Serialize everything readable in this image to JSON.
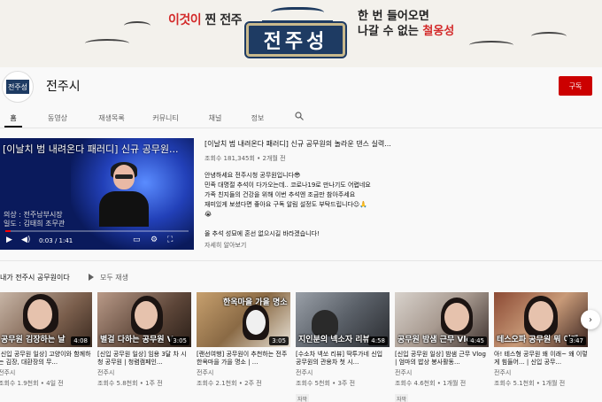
{
  "banner": {
    "left_text_red": "이것이",
    "left_text": " 찐 전주",
    "sign_text": "전주성",
    "right_line1": "한 번 들어오면",
    "right_line2_prefix": "나갈 수 없는 ",
    "right_line2_red": "철옹성"
  },
  "channel": {
    "name": "전주시",
    "avatar_text": "전주성",
    "subscribe_label": "구독"
  },
  "tabs": [
    {
      "label": "홈",
      "active": true
    },
    {
      "label": "동영상",
      "active": false
    },
    {
      "label": "재생목록",
      "active": false
    },
    {
      "label": "커뮤니티",
      "active": false
    },
    {
      "label": "채널",
      "active": false
    },
    {
      "label": "정보",
      "active": false
    }
  ],
  "featured": {
    "player_title": "[이날치 범 내려온다 패러디] 신규 공무원...",
    "caption_line1": "의상 : 전주남부시장",
    "caption_line2": "일도 : 김태희 조무관",
    "time": "0:03 / 1:41",
    "progress": 0.03,
    "title": "[이날치 범 내려온다 패러디] 신규 공무원의 놀라운 댄스 실력...",
    "meta": "조회수 181,345회 • 2개월 전",
    "description": [
      "안녕하세요 전주시청 공무원입니다😎",
      "민족 대명절 추석이 다가오는데.. 코로나19로 만나기도 어렵네요",
      "가족 친지들의 건강을 위해 이번 추석엔 조금만 참아주세요",
      "재미있게 보셨다면 좋아요 구독 알림 설정도 부탁드립니다☺🙏",
      "😭",
      "",
      "올 추석 성묘에 혼선 없으시길 바라겠습니다!"
    ],
    "more_label": "자세히 알아보기"
  },
  "shelf": {
    "title": "내가 전주시 공무원이다",
    "play_all_label": "모두 재생",
    "videos": [
      {
        "thumb_caption": "공무원 김장하는 날",
        "duration": "4:08",
        "title": "[신입 공무원 일상] 고양이와 함께하는 김장, 대환장의 무...",
        "channel": "전주시",
        "meta": "조회수 1.9천회 • 4일 전",
        "badge": ""
      },
      {
        "thumb_caption": "별걸 다하는 공무원 V",
        "duration": "3:05",
        "title": "[신입 공무원 일상] 임용 3달 차 시청 공무원 | 청렴캠페인...",
        "channel": "전주시",
        "meta": "조회수 5.8천회 • 1주 전",
        "badge": ""
      },
      {
        "thumb_caption": "한옥마을 가을 명소",
        "duration": "3:05",
        "title": "[랜선여행] 공무원이 추천하는 전주 한옥마을 가을 명소 | ...",
        "channel": "전주시",
        "meta": "조회수 2.1천회 • 2주 전",
        "badge": ""
      },
      {
        "thumb_caption": "지인분의 넥소자 리뷰",
        "duration": "4:58",
        "title": "[수소차 넥쏘 리뷰] 딱투가네 신입 공무원의 관용차 첫 시...",
        "channel": "전주시",
        "meta": "조회수 5천회 • 3주 전",
        "badge": "자막"
      },
      {
        "thumb_caption": "공무원 밤샘 근무 Vlo",
        "duration": "4:45",
        "title": "[신입 공무원 일상] 밤샘 근무 Vlog | 엄마의 밥상 봉사활동...",
        "channel": "전주시",
        "meta": "조회수 4.6천회 • 1개월 전",
        "badge": "자막"
      },
      {
        "thumb_caption": "테스오파 공무원 뭐 이래",
        "duration": "3:47",
        "title": "아! 테스형 공무원 왜 이래~ 왜 이렇게 힘들어... | 신입 공무...",
        "channel": "전주시",
        "meta": "조회수 5.1천회 • 1개월 전",
        "badge": ""
      }
    ]
  },
  "colors": {
    "subscribe_red": "#cc0000",
    "sign_blue": "#1e3b63",
    "progress_red": "#ff0000"
  }
}
